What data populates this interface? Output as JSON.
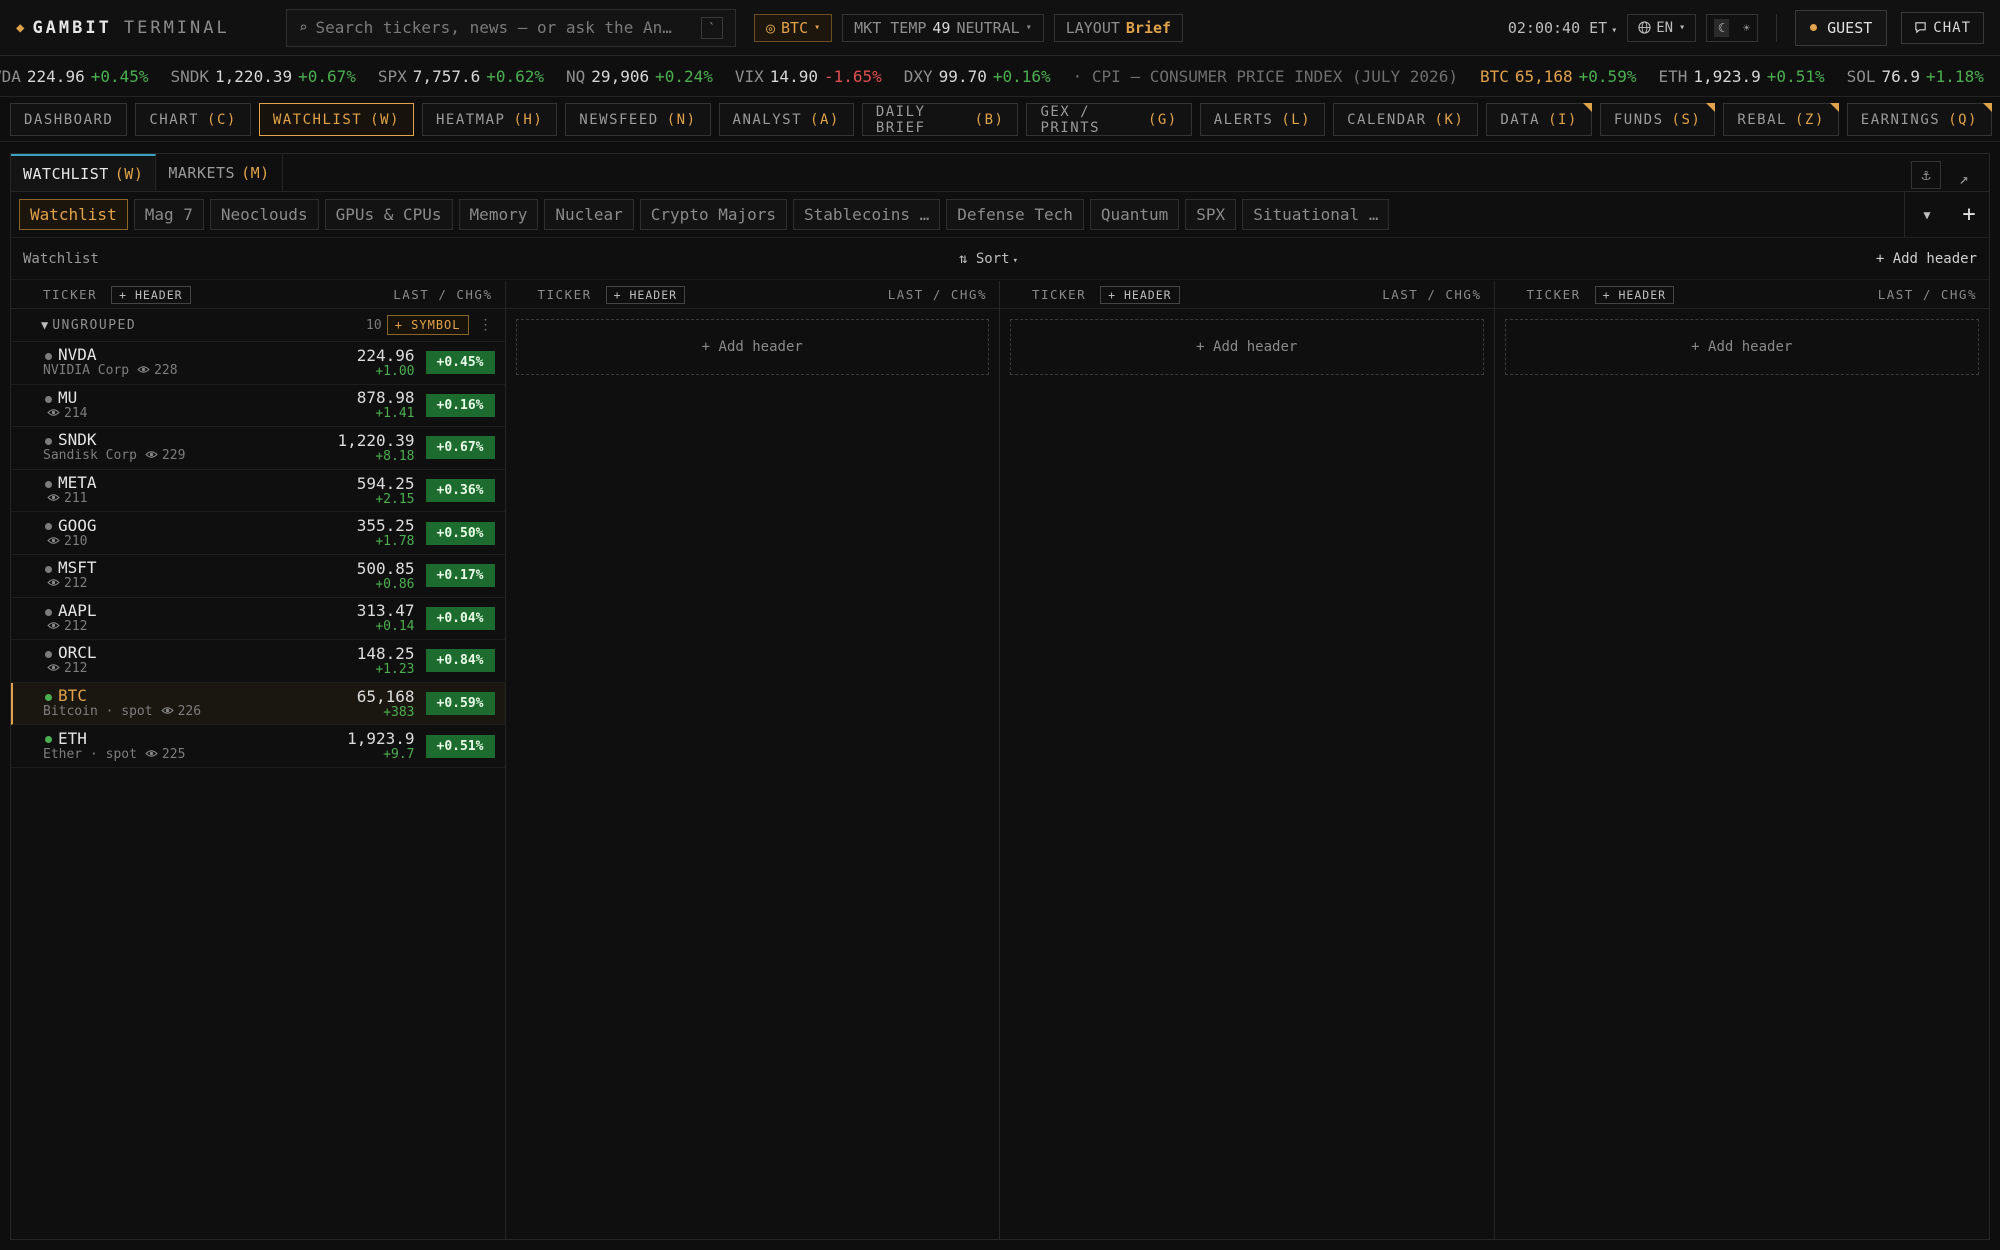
{
  "brand": {
    "name_a": "GAMBIT",
    "name_b": "TERMINAL"
  },
  "search": {
    "placeholder": "Search tickers, news — or ask the An…",
    "shortcut": "`"
  },
  "topbar": {
    "asset_label": "BTC",
    "mkt_temp_label": "MKT TEMP",
    "mkt_temp_value": "49",
    "mkt_temp_state": "NEUTRAL",
    "layout_label": "LAYOUT",
    "layout_value": "Brief",
    "clock": "02:00:40 ET",
    "language": "EN",
    "guest": "GUEST",
    "chat": "CHAT"
  },
  "tape": {
    "items": [
      {
        "sym": "VDA",
        "px": "224.96",
        "chg": "+0.45%"
      },
      {
        "sym": "SNDK",
        "px": "1,220.39",
        "chg": "+0.67%"
      },
      {
        "sym": "SPX",
        "px": "7,757.6",
        "chg": "+0.62%"
      },
      {
        "sym": "NQ",
        "px": "29,906",
        "chg": "+0.24%"
      },
      {
        "sym": "VIX",
        "px": "14.90",
        "chg": "-1.65%"
      },
      {
        "sym": "DXY",
        "px": "99.70",
        "chg": "+0.16%"
      }
    ],
    "news": "· CPI — CONSUMER PRICE INDEX (JULY 2026)",
    "crypto": [
      {
        "sym": "BTC",
        "px": "65,168",
        "chg": "+0.59%"
      },
      {
        "sym": "ETH",
        "px": "1,923.9",
        "chg": "+0.51%"
      },
      {
        "sym": "SOL",
        "px": "76.9",
        "chg": "+1.18%"
      }
    ]
  },
  "modules": [
    {
      "label": "DASHBOARD",
      "key": ""
    },
    {
      "label": "CHART",
      "key": "(C)"
    },
    {
      "label": "WATCHLIST",
      "key": "(W)"
    },
    {
      "label": "HEATMAP",
      "key": "(H)"
    },
    {
      "label": "NEWSFEED",
      "key": "(N)"
    },
    {
      "label": "ANALYST",
      "key": "(A)"
    },
    {
      "label": "DAILY BRIEF",
      "key": "(B)"
    },
    {
      "label": "GEX / PRINTS",
      "key": "(G)"
    },
    {
      "label": "ALERTS",
      "key": "(L)"
    },
    {
      "label": "CALENDAR",
      "key": "(K)"
    },
    {
      "label": "DATA",
      "key": "(I)"
    },
    {
      "label": "FUNDS",
      "key": "(S)"
    },
    {
      "label": "REBAL",
      "key": "(Z)"
    },
    {
      "label": "EARNINGS",
      "key": "(Q)"
    }
  ],
  "panel_tabs": [
    {
      "label": "WATCHLIST",
      "key": "(W)"
    },
    {
      "label": "MARKETS",
      "key": "(M)"
    }
  ],
  "lists": [
    "Watchlist",
    "Mag 7",
    "Neoclouds",
    "GPUs & CPUs",
    "Memory",
    "Nuclear",
    "Crypto Majors",
    "Stablecoins …",
    "Defense Tech",
    "Quantum",
    "SPX",
    "Situational …"
  ],
  "subbar": {
    "label": "Watchlist",
    "sort": "Sort",
    "add_header": "+ Add header"
  },
  "columns": {
    "ticker": "TICKER",
    "header_btn": "+ HEADER",
    "last_chg": "LAST / CHG%",
    "add_header": "+ Add header"
  },
  "group": {
    "name": "UNGROUPED",
    "count": "10",
    "symbol_btn": "+ SYMBOL"
  },
  "rows": [
    {
      "ticker": "NVDA",
      "name": "NVIDIA Corp",
      "watchers": "228",
      "last": "224.96",
      "chg": "+1.00",
      "pct": "+0.45%"
    },
    {
      "ticker": "MU",
      "name": "",
      "watchers": "214",
      "last": "878.98",
      "chg": "+1.41",
      "pct": "+0.16%"
    },
    {
      "ticker": "SNDK",
      "name": "Sandisk Corp",
      "watchers": "229",
      "last": "1,220.39",
      "chg": "+8.18",
      "pct": "+0.67%"
    },
    {
      "ticker": "META",
      "name": "",
      "watchers": "211",
      "last": "594.25",
      "chg": "+2.15",
      "pct": "+0.36%"
    },
    {
      "ticker": "GOOG",
      "name": "",
      "watchers": "210",
      "last": "355.25",
      "chg": "+1.78",
      "pct": "+0.50%"
    },
    {
      "ticker": "MSFT",
      "name": "",
      "watchers": "212",
      "last": "500.85",
      "chg": "+0.86",
      "pct": "+0.17%"
    },
    {
      "ticker": "AAPL",
      "name": "",
      "watchers": "212",
      "last": "313.47",
      "chg": "+0.14",
      "pct": "+0.04%"
    },
    {
      "ticker": "ORCL",
      "name": "",
      "watchers": "212",
      "last": "148.25",
      "chg": "+1.23",
      "pct": "+0.84%"
    },
    {
      "ticker": "BTC",
      "name": "Bitcoin · spot",
      "watchers": "226",
      "last": "65,168",
      "chg": "+383",
      "pct": "+0.59%"
    },
    {
      "ticker": "ETH",
      "name": "Ether · spot",
      "watchers": "225",
      "last": "1,923.9",
      "chg": "+9.7",
      "pct": "+0.51%"
    }
  ],
  "colors": {
    "accent": "#e0a24a",
    "up": "#4caf50",
    "down": "#e05050",
    "tab_active": "#3aa3c4"
  }
}
